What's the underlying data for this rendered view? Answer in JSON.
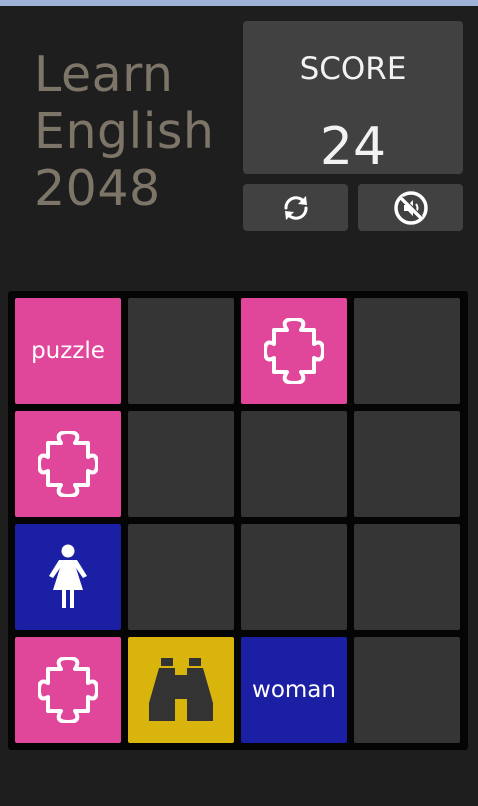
{
  "header": {
    "title_lines": [
      "Learn",
      "English",
      "2048"
    ]
  },
  "score": {
    "label": "SCORE",
    "value": "24"
  },
  "controls": {
    "restart_icon": "refresh-icon",
    "sound_icon": "sound-off-icon"
  },
  "board": {
    "rows": [
      [
        {
          "type": "word",
          "text": "puzzle",
          "color": "#e0479a"
        },
        {
          "type": "empty"
        },
        {
          "type": "icon",
          "icon": "puzzle-icon",
          "color": "#e0479a"
        },
        {
          "type": "empty"
        }
      ],
      [
        {
          "type": "icon",
          "icon": "puzzle-icon",
          "color": "#e0479a"
        },
        {
          "type": "empty"
        },
        {
          "type": "empty"
        },
        {
          "type": "empty"
        }
      ],
      [
        {
          "type": "icon",
          "icon": "woman-icon",
          "color": "#1b1fa3"
        },
        {
          "type": "empty"
        },
        {
          "type": "empty"
        },
        {
          "type": "empty"
        }
      ],
      [
        {
          "type": "icon",
          "icon": "puzzle-icon",
          "color": "#e0479a"
        },
        {
          "type": "icon",
          "icon": "binoculars-icon",
          "color": "#d8b40c"
        },
        {
          "type": "word",
          "text": "woman",
          "color": "#1b1fa3"
        },
        {
          "type": "empty"
        }
      ]
    ]
  }
}
